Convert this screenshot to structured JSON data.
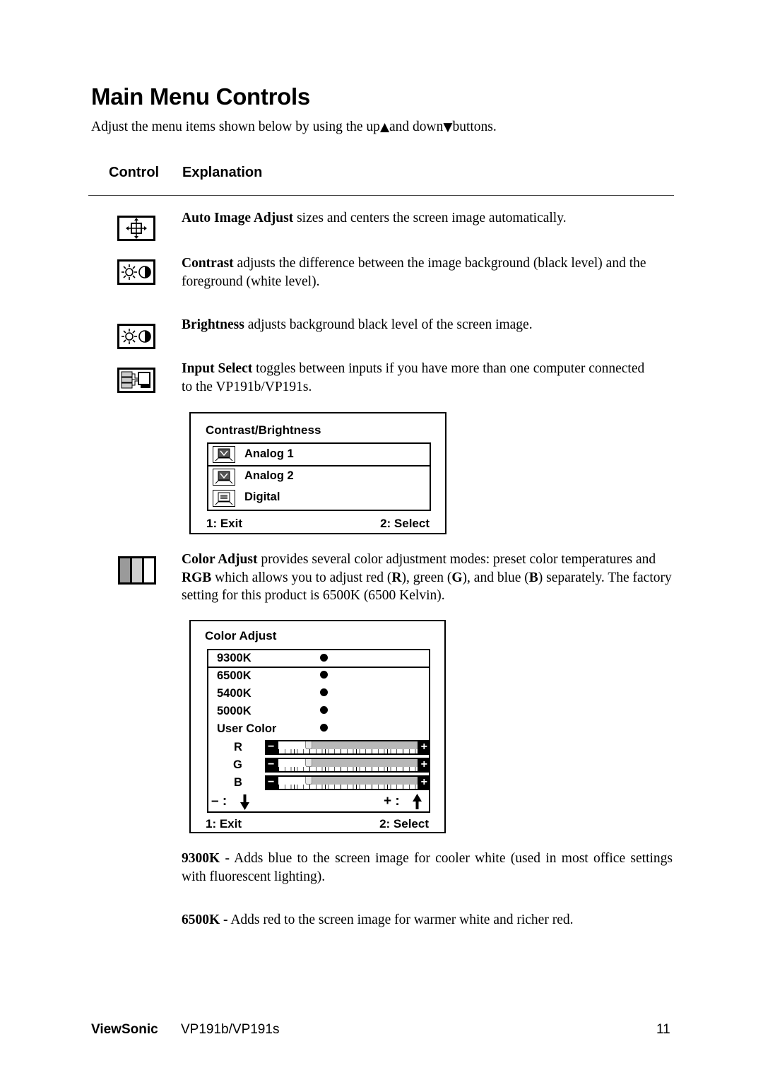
{
  "page": {
    "title": "Main Menu Controls",
    "intro_before_up": "Adjust the menu items shown below by using the up",
    "up_glyph": "▲",
    "intro_between": "and down",
    "down_glyph": "▼",
    "intro_after": "buttons."
  },
  "table_header": {
    "control": "Control",
    "explanation": "Explanation"
  },
  "controls": [
    {
      "icon": "auto-image-adjust-icon",
      "term": "Auto Image Adjust",
      "text": " sizes and centers the screen image automatically."
    },
    {
      "icon": "contrast-icon",
      "term": "Contrast",
      "text": " adjusts the difference between the image background  (black level) and the foreground (white level)."
    },
    {
      "icon": "brightness-icon",
      "term": "Brightness",
      "text": " adjusts background black level of the screen image."
    },
    {
      "icon": "input-select-icon",
      "term": "Input Select",
      "text": " toggles between inputs if you have more than one computer connected to the VP191b/VP191s."
    },
    {
      "icon": "color-adjust-icon",
      "term": "Color Adjust",
      "text_1": " provides several color adjustment modes: preset color temperatures and ",
      "term_rgb": "RGB",
      "text_2": " which allows you to adjust red (",
      "r": "R",
      "text_3": "), green (",
      "g": "G",
      "text_4": "), and blue (",
      "b": "B",
      "text_5": ") separately. The factory setting for this product is 6500K (6500 Kelvin)."
    }
  ],
  "osd_contrast": {
    "title": "Contrast/Brightness",
    "items": [
      {
        "label": "Analog 1",
        "icon": "analog-monitor-icon",
        "selected": true
      },
      {
        "label": "Analog 2",
        "icon": "analog-monitor-icon",
        "selected": false
      },
      {
        "label": "Digital",
        "icon": "digital-monitor-icon",
        "selected": false
      }
    ],
    "exit": "1: Exit",
    "select": "2: Select"
  },
  "osd_color": {
    "title": "Color Adjust",
    "presets": [
      {
        "label": "9300K",
        "selected": true
      },
      {
        "label": "6500K",
        "selected": false
      },
      {
        "label": "5400K",
        "selected": false
      },
      {
        "label": "5000K",
        "selected": false
      },
      {
        "label": "User Color",
        "selected": false
      }
    ],
    "sliders": [
      {
        "label": "R",
        "value_pct": 20
      },
      {
        "label": "G",
        "value_pct": 20
      },
      {
        "label": "B",
        "value_pct": 20
      }
    ],
    "minus_sign": "−",
    "plus_sign": "+",
    "minus_hint": "– :",
    "plus_hint": "+ :",
    "down_arrow": "🡇",
    "up_arrow": "🡅",
    "exit": "1: Exit",
    "select": "2: Select"
  },
  "presets_explained": [
    {
      "term": "9300K -",
      "text": " Adds blue to the screen image for cooler white (used in most office settings with fluorescent lighting)."
    },
    {
      "term": "6500K -",
      "text": " Adds red to the screen image for warmer white and richer red."
    }
  ],
  "footer": {
    "brand": "ViewSonic",
    "model": "VP191b/VP191s",
    "page_number": "11"
  }
}
